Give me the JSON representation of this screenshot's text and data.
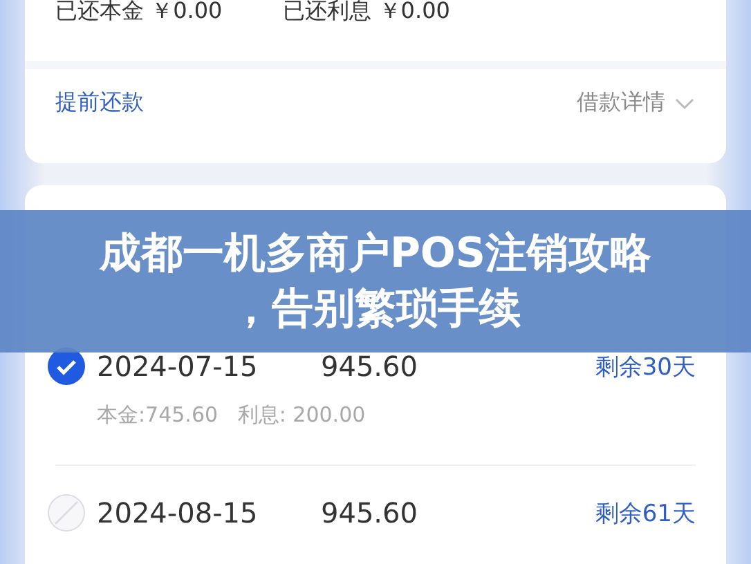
{
  "summary": {
    "repaid_principal": "已还本金 ￥0.00",
    "repaid_interest": "已还利息 ￥0.00"
  },
  "actions": {
    "prepay_link": "提前还款",
    "details_link": "借款详情"
  },
  "schedule": {
    "rows": [
      {
        "date": "2024-07-15",
        "amount": "945.60",
        "remaining": "剩余30天",
        "breakdown": "本金:745.60   利息: 200.00",
        "checked": true,
        "disabled": false
      },
      {
        "date": "2024-08-15",
        "amount": "945.60",
        "remaining": "剩余61天",
        "checked": false,
        "disabled": true
      }
    ]
  },
  "banner": {
    "title_lines": [
      "成都一机多商户POS注销攻略",
      "，告别繁琐手续"
    ]
  }
}
